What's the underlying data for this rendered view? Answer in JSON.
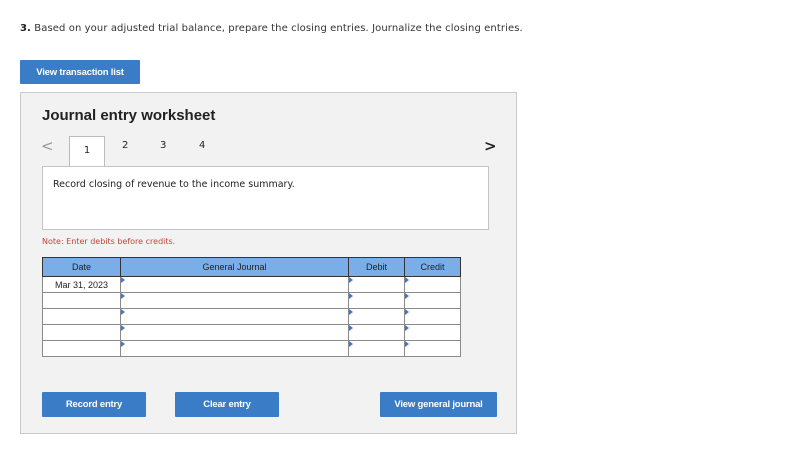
{
  "question": {
    "number": "3.",
    "text": "Based on your adjusted trial balance, prepare the closing entries. Journalize the closing entries."
  },
  "buttons": {
    "view_transactions": "View transaction list",
    "record_entry": "Record entry",
    "clear_entry": "Clear entry",
    "view_general_journal": "View general journal"
  },
  "worksheet": {
    "title": "Journal entry worksheet",
    "nav_prev": "<",
    "nav_next": ">",
    "tabs": [
      "1",
      "2",
      "3",
      "4"
    ],
    "active_tab": "1",
    "description": "Record closing of revenue to the income summary.",
    "note": "Note: Enter debits before credits."
  },
  "table": {
    "headers": {
      "date": "Date",
      "general_journal": "General Journal",
      "debit": "Debit",
      "credit": "Credit"
    },
    "rows": [
      {
        "date": "Mar 31, 2023",
        "account": "",
        "debit": "",
        "credit": ""
      },
      {
        "date": "",
        "account": "",
        "debit": "",
        "credit": ""
      },
      {
        "date": "",
        "account": "",
        "debit": "",
        "credit": ""
      },
      {
        "date": "",
        "account": "",
        "debit": "",
        "credit": ""
      },
      {
        "date": "",
        "account": "",
        "debit": "",
        "credit": ""
      }
    ]
  },
  "colors": {
    "button_blue": "#3a7cc6",
    "header_blue": "#7aaee6",
    "note_red": "#c4453a"
  }
}
